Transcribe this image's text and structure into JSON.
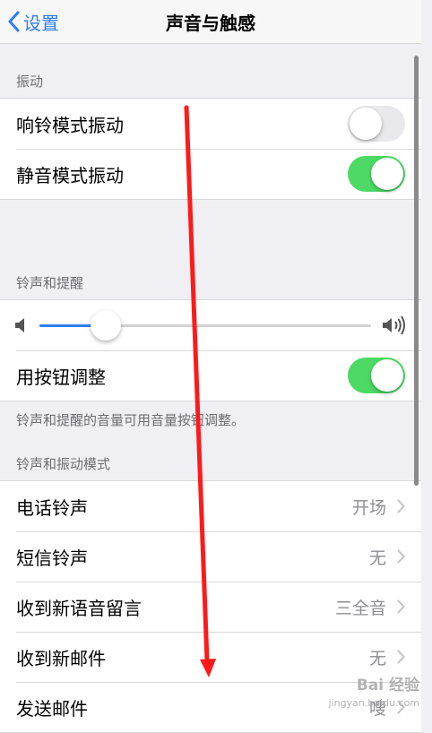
{
  "nav": {
    "back_label": "设置",
    "title": "声音与触感"
  },
  "vibrate": {
    "header": "振动",
    "rows": [
      {
        "label": "响铃模式振动",
        "on": false
      },
      {
        "label": "静音模式振动",
        "on": true
      }
    ]
  },
  "ringer": {
    "header": "铃声和提醒",
    "volume": 0.2,
    "change_with_buttons_label": "用按钮调整",
    "change_with_buttons_on": true,
    "footer": "铃声和提醒的音量可用音量按钮调整。"
  },
  "patterns": {
    "header": "铃声和振动模式",
    "rows": [
      {
        "label": "电话铃声",
        "value": "开场"
      },
      {
        "label": "短信铃声",
        "value": "无"
      },
      {
        "label": "收到新语音留言",
        "value": "三全音"
      },
      {
        "label": "收到新邮件",
        "value": "无"
      },
      {
        "label": "发送邮件",
        "value": "嗖"
      }
    ]
  },
  "watermark": {
    "text": "Bai 经验",
    "sub": "jingyan.baidu.com"
  },
  "colors": {
    "accent": "#2f7cf6",
    "toggle_on": "#4cd964",
    "annotation_arrow": "#ff1a1a"
  },
  "icons": {
    "back": "chevron-left-icon",
    "volume_low": "speaker-low-icon",
    "volume_high": "speaker-high-icon",
    "disclosure": "chevron-right-icon"
  }
}
